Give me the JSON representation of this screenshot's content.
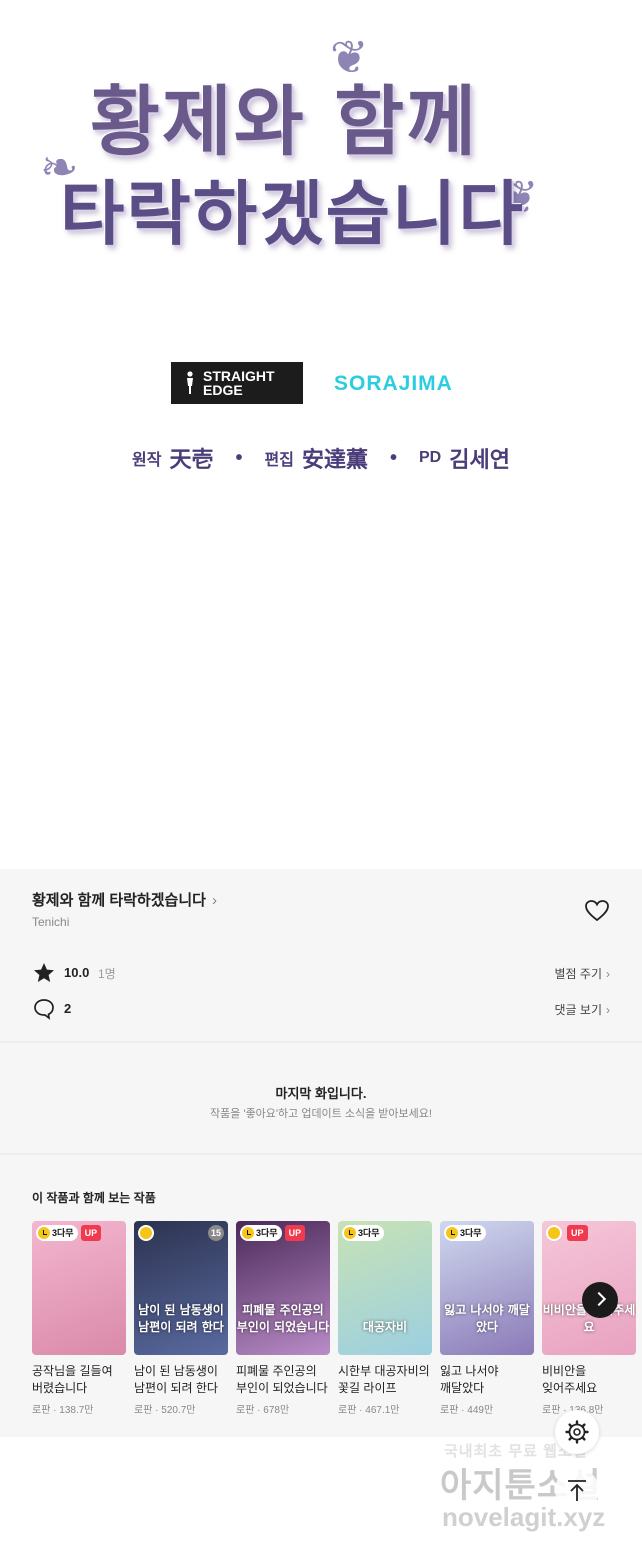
{
  "episode": {
    "title_art_line1": "황제와 함께",
    "title_art_line2": "타락하겠습니다",
    "brands": {
      "studio": "STRAIGHT EDGE",
      "partner": "SORAJIMA"
    },
    "credits": [
      {
        "role": "원작",
        "name": "天壱"
      },
      {
        "role": "편집",
        "name": "安達薫"
      },
      {
        "role": "PD",
        "name": "김세연"
      }
    ],
    "separator": "•"
  },
  "work": {
    "title": "황제와 함께 타락하겠습니다",
    "title_chevron": "›",
    "author": "Tenichi",
    "rating": "10.0",
    "rating_count": "1명",
    "rate_action": "별점 주기",
    "comment_count": "2",
    "comment_action": "댓글 보기",
    "action_chevron": "›"
  },
  "last_episode": {
    "title": "마지막 화입니다.",
    "subtitle": "작품을 '좋아요'하고 업데이트 소식을 받아보세요!"
  },
  "recommendations": {
    "heading": "이 작품과 함께 보는 작품",
    "items": [
      {
        "title": "공작님을 길들여 버렸습니다",
        "meta": "로판 · 138.7만",
        "badge_wait": "3다무",
        "badge_up": "UP",
        "cover_text": "",
        "colors": [
          "#f4b6cf",
          "#d98aa8"
        ]
      },
      {
        "title": "남이 된 남동생이 남편이 되려 한다",
        "meta": "로판 · 520.7만",
        "badge_num": "15",
        "cover_text": "남이 된 남동생이 남편이 되려 한다",
        "colors": [
          "#2c3350",
          "#5a6aa0"
        ]
      },
      {
        "title": "피폐물 주인공의 부인이 되었습니다",
        "meta": "로판 · 678만",
        "badge_wait": "3다무",
        "badge_up": "UP",
        "cover_text": "피폐물 주인공의 부인이 되었습니다",
        "colors": [
          "#4b2a5a",
          "#b98cc7"
        ]
      },
      {
        "title": "시한부 대공자비의 꽃길 라이프",
        "meta": "로판 · 467.1만",
        "badge_wait": "3다무",
        "cover_text": "대공자비",
        "colors": [
          "#c7e2b5",
          "#9ccfe0"
        ]
      },
      {
        "title": "잃고 나서야 깨달았다",
        "meta": "로판 · 449만",
        "badge_wait": "3다무",
        "cover_text": "잃고 나서야 깨달았다",
        "colors": [
          "#cfd8ee",
          "#8b7ab8"
        ]
      },
      {
        "title": "비비안을 잊어주세요",
        "meta": "로판 · 136.8만",
        "badge_up": "UP",
        "cover_text": "비비안을 잊어주세요",
        "colors": [
          "#f5c6d8",
          "#e8a2c0"
        ]
      }
    ]
  },
  "watermark": {
    "line1": "국내최초 무료 웹소설",
    "line2": "아지툰소설",
    "line3": "novelagit.xyz"
  },
  "colors": {
    "accent_purple": "#4b3d7a",
    "sorajima": "#2ccde0",
    "up_badge": "#f03b4f",
    "wait_clock": "#f5c518"
  },
  "icons": [
    "heart-icon",
    "star-icon",
    "comment-icon",
    "chevron-right-icon",
    "settings-icon",
    "arrow-up-icon",
    "clock-icon"
  ]
}
